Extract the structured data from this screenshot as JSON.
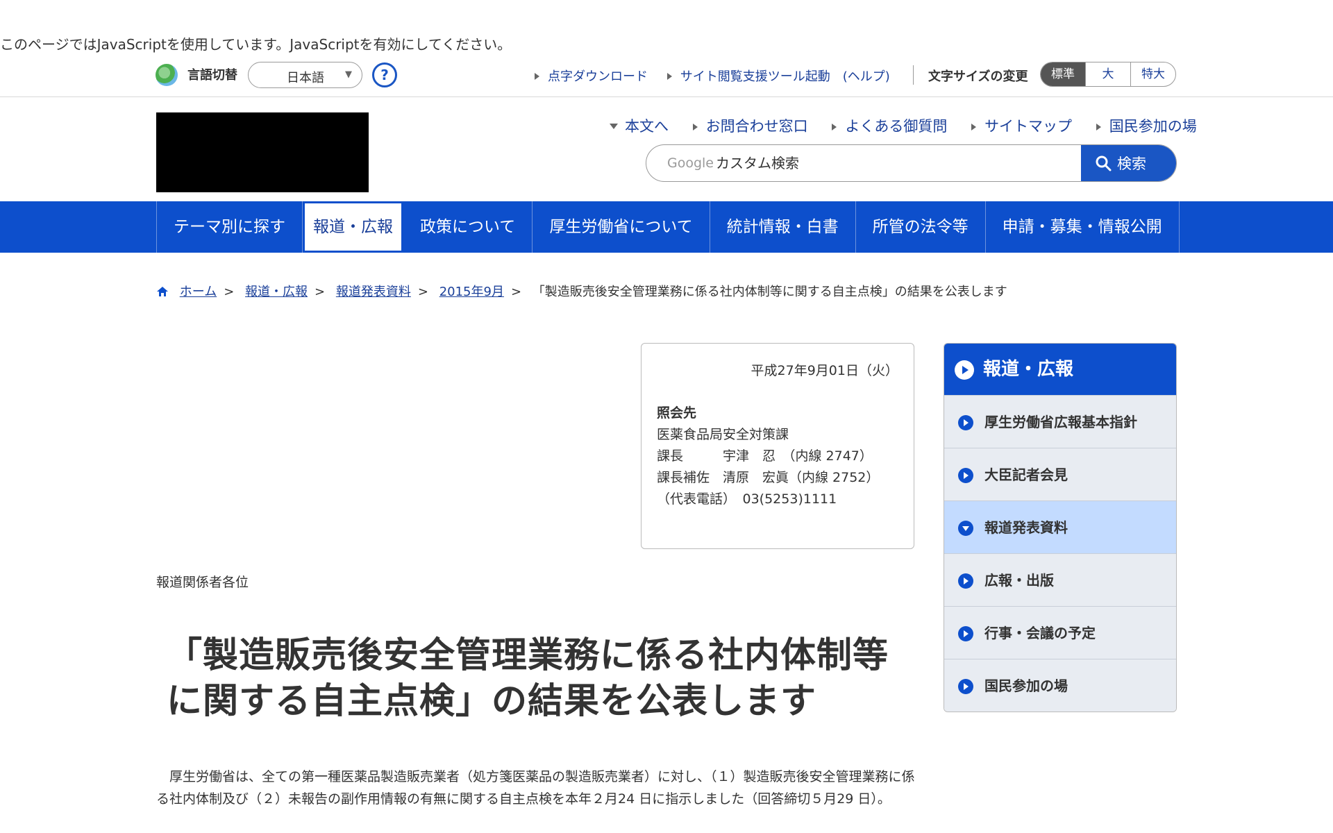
{
  "noscript_message": "このページではJavaScriptを使用しています。JavaScriptを有効にしてください。",
  "utility": {
    "language_label": "言語切替",
    "language_selected": "日本語",
    "help_symbol": "?",
    "links": [
      "点字ダウンロード",
      "サイト閲覧支援ツール起動　(ヘルプ)"
    ],
    "font_size_label": "文字サイズの変更",
    "font_sizes": [
      "標準",
      "大",
      "特大"
    ]
  },
  "header": {
    "links": [
      "本文へ",
      "お問合わせ窓口",
      "よくある御質問",
      "サイトマップ",
      "国民参加の場"
    ],
    "search": {
      "brand": "Google",
      "placeholder": "カスタム検索",
      "button_label": "検索"
    }
  },
  "global_nav": [
    "テーマ別に探す",
    "報道・広報",
    "政策について",
    "厚生労働省について",
    "統計情報・白書",
    "所管の法令等",
    "申請・募集・情報公開"
  ],
  "breadcrumb": {
    "links": [
      "ホーム",
      "報道・広報",
      "報道発表資料",
      "2015年9月"
    ],
    "current": "「製造販売後安全管理業務に係る社内体制等に関する自主点検」の結果を公表します"
  },
  "contact": {
    "date": "平成27年9月01日（火）",
    "title": "照会先",
    "lines": [
      "医薬食品局安全対策課",
      "課長　　　宇津　忍　（内線 2747）",
      "課長補佐　清原　宏眞（内線 2752）",
      "（代表電話）　03(5253)1111"
    ]
  },
  "addressee": "報道関係者各位",
  "headline": "「製造販売後安全管理業務に係る社内体制等に関する自主点検」の結果を公表します",
  "body_text": "厚生労働省は、全ての第一種医薬品製造販売業者（処方箋医薬品の製造販売業者）に対し、（１）製造販売後安全管理業務に係る社内体制及び（２）未報告の副作用情報の有無に関する自主点検を本年２月24 日に指示しました（回答締切５月29 日）。",
  "sidebar": {
    "title": "報道・広報",
    "items": [
      "厚生労働省広報基本指針",
      "大臣記者会見",
      "報道発表資料",
      "広報・出版",
      "行事・会議の予定",
      "国民参加の場"
    ]
  },
  "colors": {
    "primary_blue": "#0d4fcc",
    "link_blue": "#1a3f99",
    "sidebar_current": "#c3dbff"
  }
}
